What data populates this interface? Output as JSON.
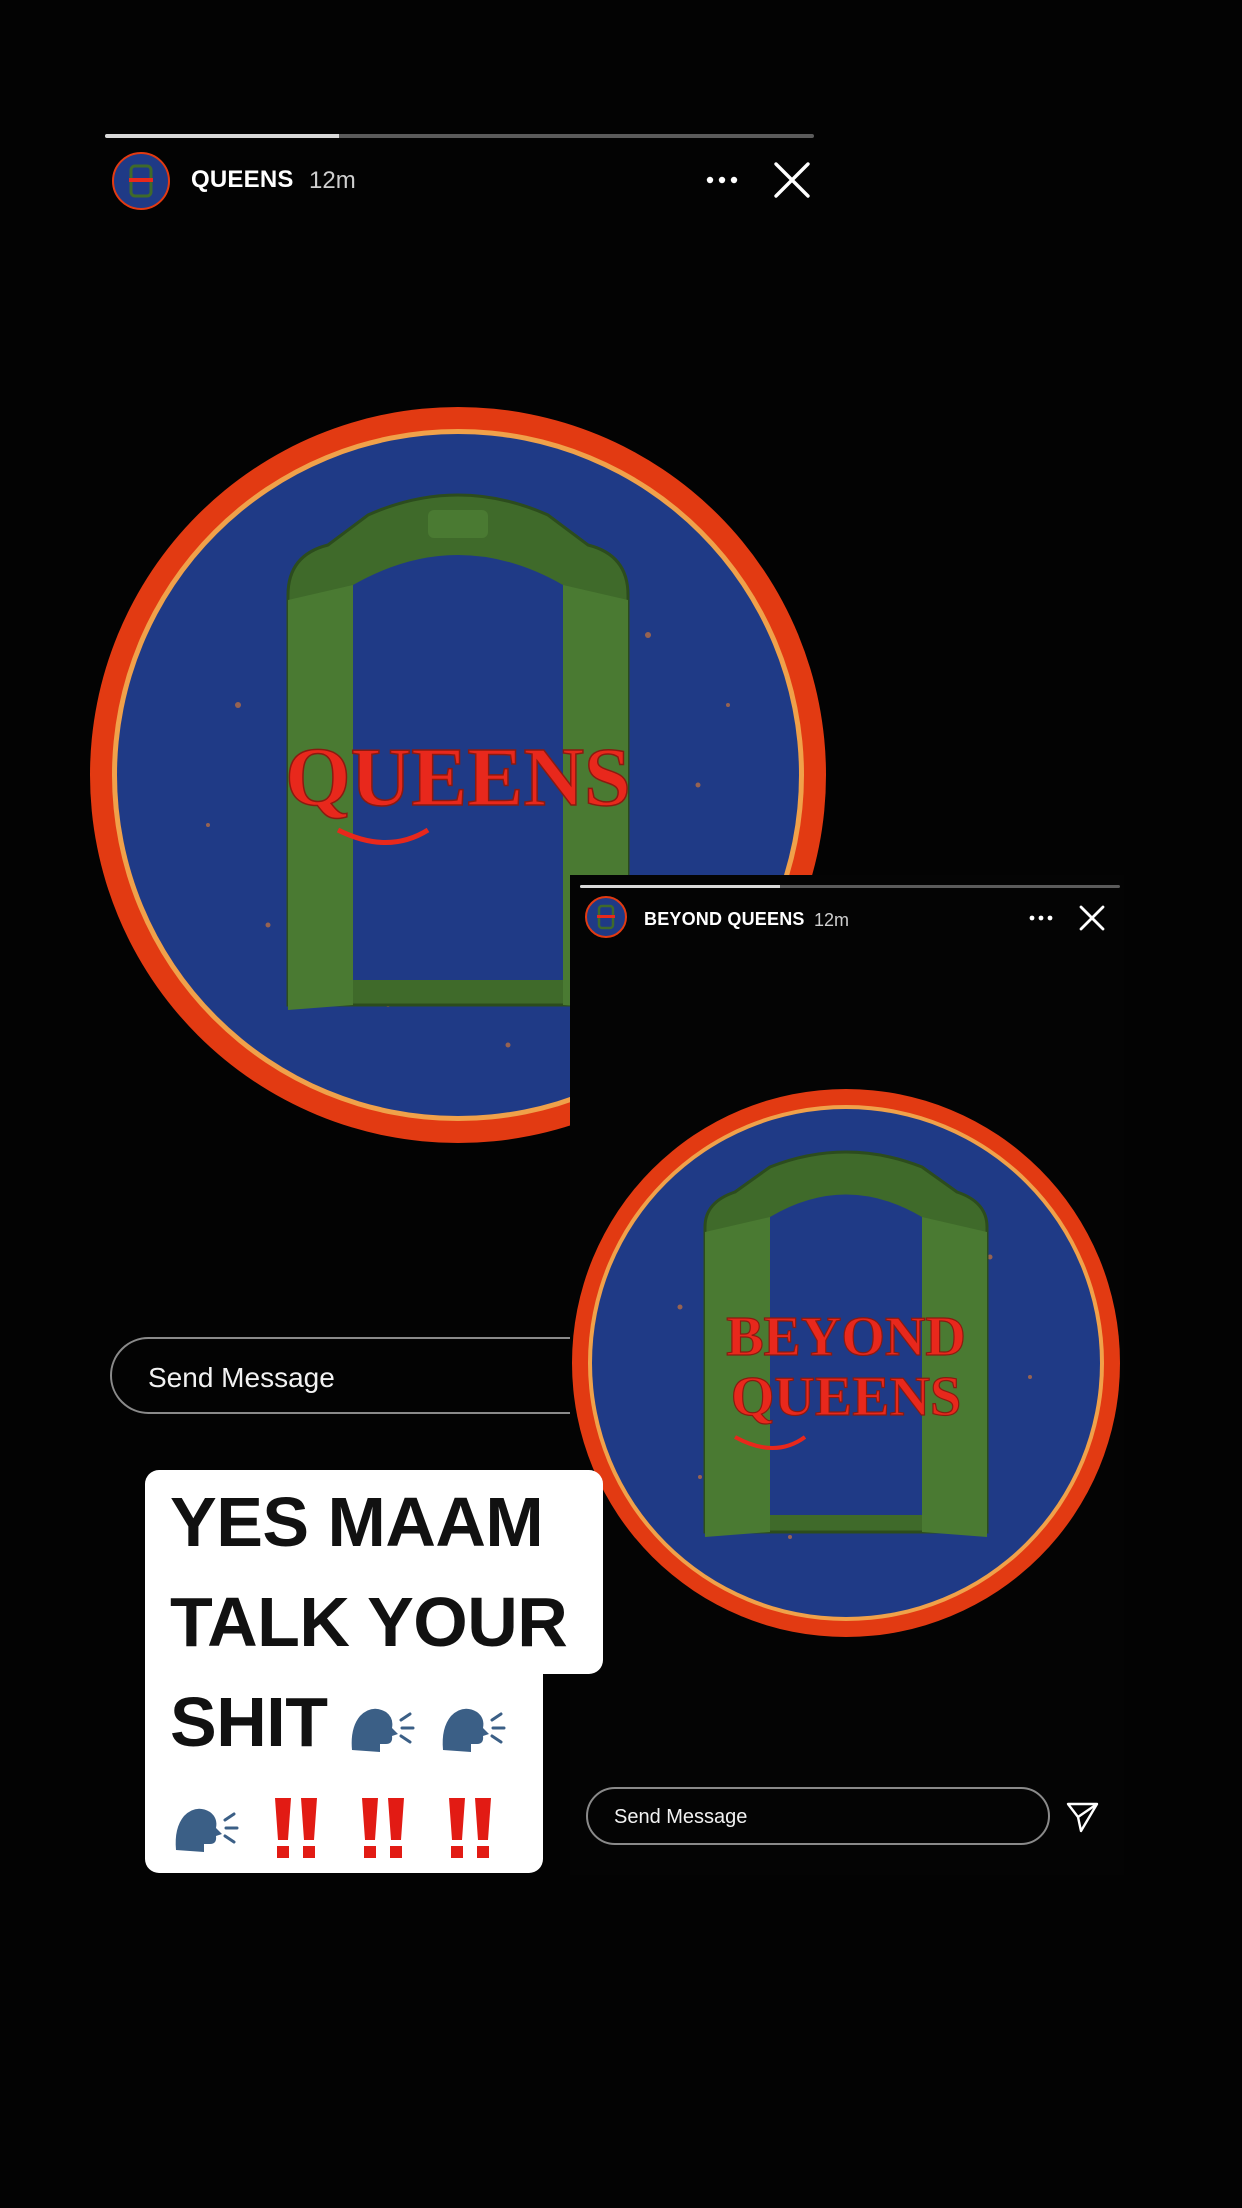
{
  "main_story": {
    "username": "QUEENS",
    "time_ago": "12m",
    "progress": 0.33,
    "patch_text": "QUEENS",
    "send_placeholder": "Send Message"
  },
  "inset_story": {
    "username": "BEYOND QUEENS",
    "time_ago": "12m",
    "progress": 0.37,
    "patch_line1": "BEYOND",
    "patch_line2": "QUEENS",
    "send_placeholder": "Send Message"
  },
  "sticker": {
    "line1": "YES MAAM",
    "line2": "TALK YOUR",
    "line3": "SHIT",
    "emojis": "🗣️🗣️🗣️‼️‼️‼️"
  },
  "colors": {
    "patch_blue": "#1f3a86",
    "patch_rim": "#e23a12",
    "door_green": "#3f6a2a",
    "lettering_red": "#e8281c",
    "sticker_bg": "#ffffff"
  },
  "icons": {
    "more": "more-horizontal-icon",
    "close": "close-icon",
    "send": "paper-plane-icon",
    "speaking_head": "speaking-head-icon",
    "double_exclamation": "double-exclamation-icon"
  }
}
